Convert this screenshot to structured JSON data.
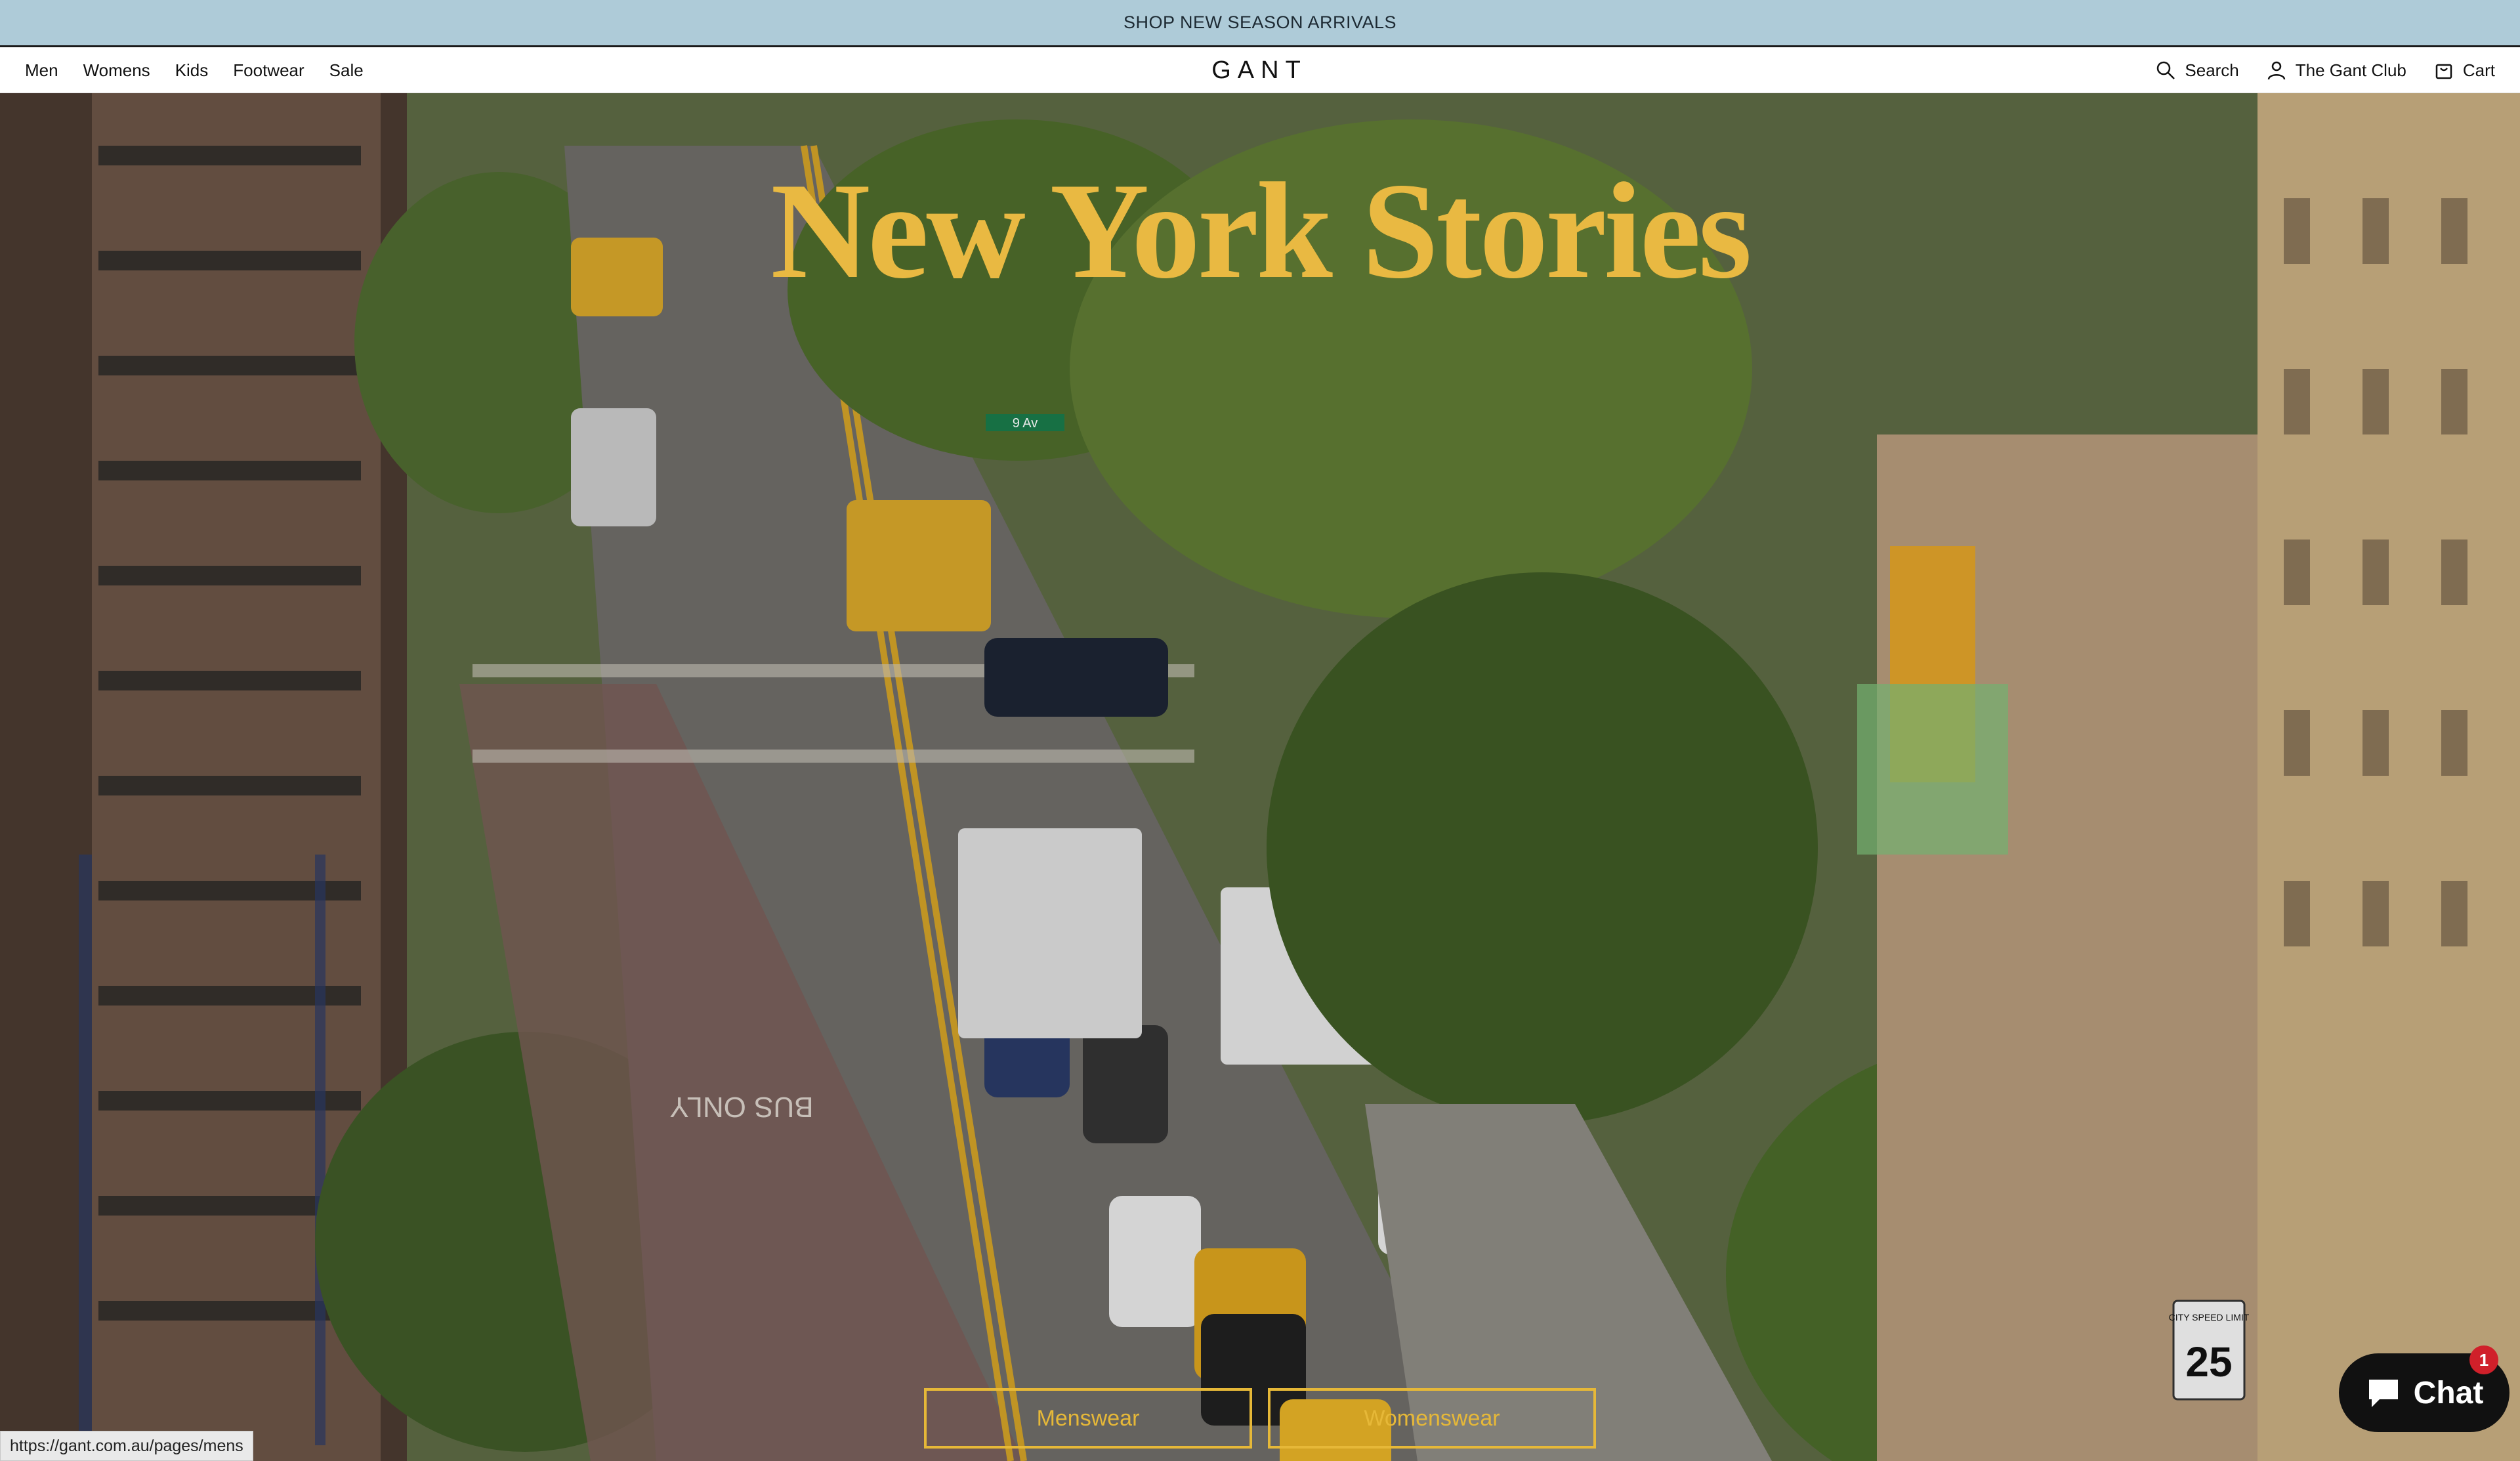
{
  "announcement": {
    "text": "SHOP NEW SEASON ARRIVALS"
  },
  "nav": {
    "left": [
      {
        "label": "Men"
      },
      {
        "label": "Womens"
      },
      {
        "label": "Kids"
      },
      {
        "label": "Footwear"
      },
      {
        "label": "Sale"
      }
    ],
    "logo": "GANT",
    "search_label": "Search",
    "club_label": "The Gant Club",
    "cart_label": "Cart"
  },
  "hero": {
    "title": "New York Stories",
    "cta_men": "Menswear",
    "cta_women": "Womenswear",
    "sign_9av": "9 Av",
    "speed_limit_top": "CITY SPEED LIMIT",
    "speed_limit_value": "25",
    "road_marking": "BUS ONLY"
  },
  "status_bar": {
    "url": "https://gant.com.au/pages/mens"
  },
  "chat": {
    "label": "Chat",
    "badge": "1"
  },
  "colors": {
    "accent": "#e9b942",
    "announcement_bg": "#aecbd8"
  }
}
